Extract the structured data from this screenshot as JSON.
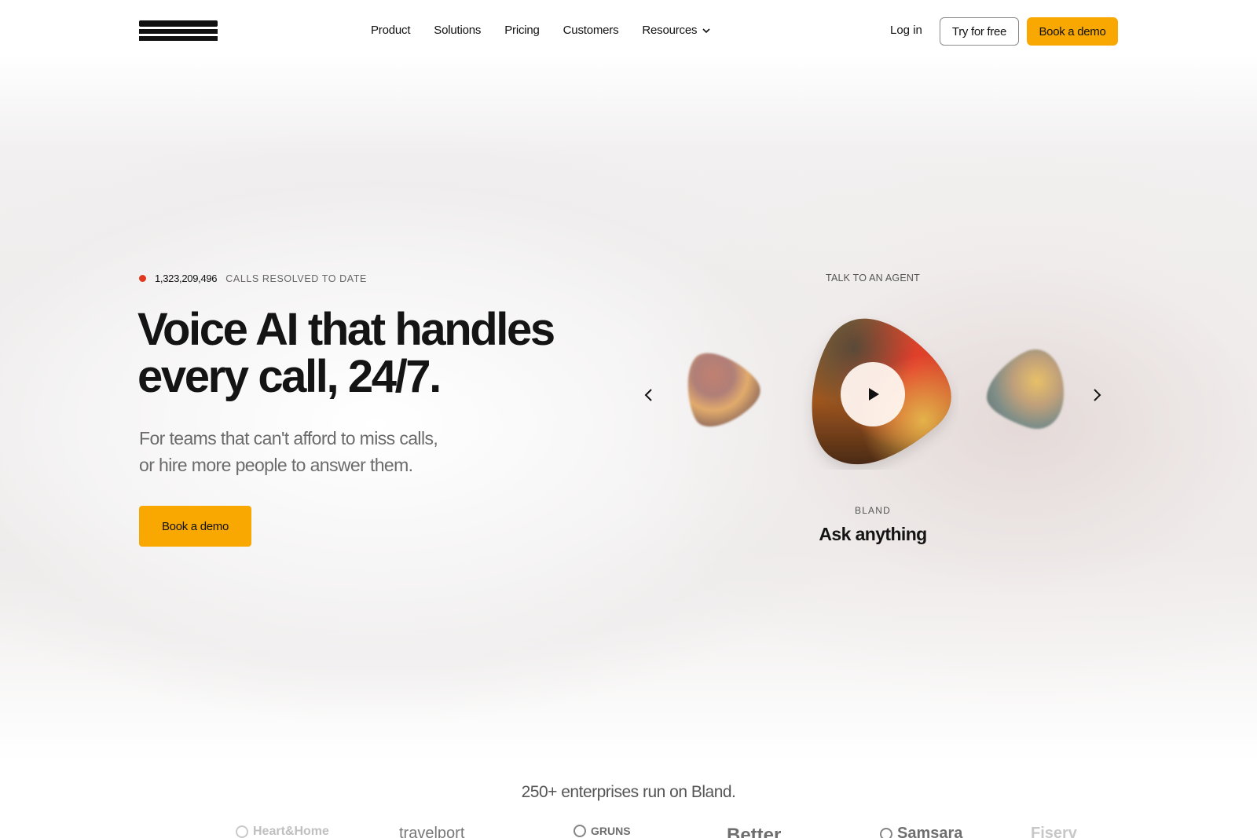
{
  "nav": {
    "logo_alt": "Bland",
    "links": [
      {
        "label": "Product"
      },
      {
        "label": "Solutions"
      },
      {
        "label": "Pricing"
      },
      {
        "label": "Customers"
      },
      {
        "label": "Resources",
        "has_dropdown": true
      }
    ],
    "login_label": "Log in",
    "try_label": "Try for free",
    "demo_label": "Book a demo"
  },
  "hero": {
    "stat_value": "1,323,209,496",
    "stat_label": "CALLS RESOLVED TO DATE",
    "headline_line1": "Voice AI that handles",
    "headline_line2": "every call, 24/7.",
    "subhead_line1": "For teams that can't afford to miss calls,",
    "subhead_line2": "or hire more people to answer them.",
    "cta_label": "Book a demo"
  },
  "agent": {
    "section_label": "TALK TO AN AGENT",
    "brand": "BLAND",
    "name": "Ask anything"
  },
  "customers": {
    "heading": "250+ enterprises run on Bland.",
    "logos": [
      "Heart&Home",
      "travelport",
      "GRUNS",
      "Better",
      "Samsara",
      "Fiserv"
    ]
  },
  "colors": {
    "accent": "#f8a800",
    "live_dot": "#e0391f",
    "text": "#141414",
    "muted": "#6b6b6b"
  },
  "icons": {
    "resources_dropdown": "chevron-down-icon",
    "prev": "chevron-left-icon",
    "next": "chevron-right-icon",
    "play": "play-icon"
  }
}
